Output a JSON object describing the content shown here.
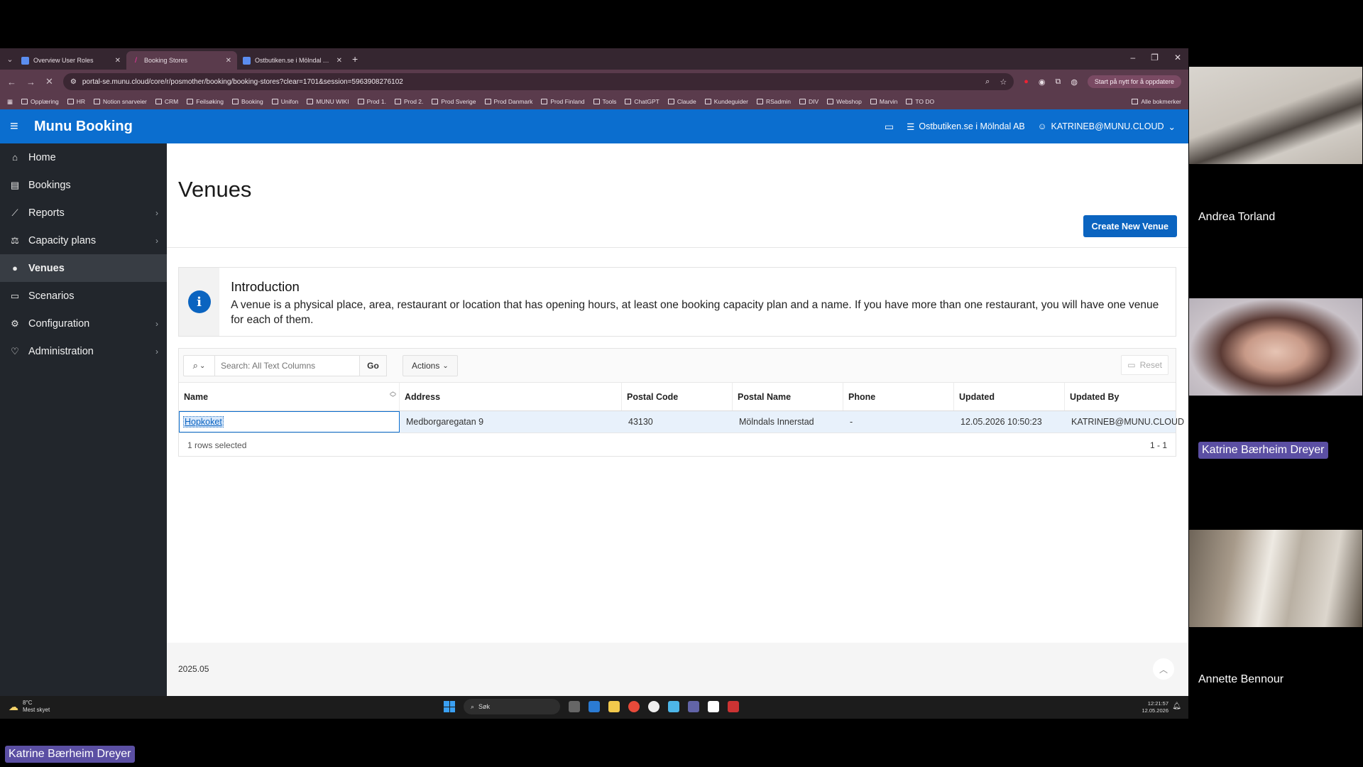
{
  "browser": {
    "tabs": [
      {
        "title": "Overview User Roles"
      },
      {
        "title": "Booking Stores"
      },
      {
        "title": "Ostbutiken.se i Mölndal AB Bo..."
      }
    ],
    "url": "portal-se.munu.cloud/core/r/posmother/booking/booking-stores?clear=1701&session=5963908276102",
    "update_button": "Start på nytt for å oppdatere",
    "bookmarks": [
      "Opplæring",
      "HR",
      "Notion snarveier",
      "CRM",
      "Feilsøking",
      "Booking",
      "Unifon",
      "MUNU WIKI",
      "Prod 1.",
      "Prod 2.",
      "Prod Sverige",
      "Prod Danmark",
      "Prod Finland",
      "Tools",
      "ChatGPT",
      "Claude",
      "Kundeguider",
      "RSadmin",
      "DIV",
      "Webshop",
      "Marvin",
      "TO DO"
    ],
    "bookmarks_right": "Alle bokmerker"
  },
  "app": {
    "title": "Munu Booking",
    "org": "Ostbutiken.se i Mölndal AB",
    "user": "KATRINEB@MUNU.CLOUD"
  },
  "sidebar": {
    "items": [
      {
        "label": "Home",
        "icon": "home-icon"
      },
      {
        "label": "Bookings",
        "icon": "calendar-icon"
      },
      {
        "label": "Reports",
        "icon": "chart-icon"
      },
      {
        "label": "Capacity plans",
        "icon": "capacity-icon"
      },
      {
        "label": "Venues",
        "icon": "location-pin-icon"
      },
      {
        "label": "Scenarios",
        "icon": "scenario-icon"
      },
      {
        "label": "Configuration",
        "icon": "gear-icon"
      },
      {
        "label": "Administration",
        "icon": "admin-icon"
      }
    ]
  },
  "page": {
    "title": "Venues",
    "create_button": "Create New Venue",
    "intro_title": "Introduction",
    "intro_text": "A venue is a physical place, area, restaurant or location that has opening hours, at least one booking capacity plan and a name. If you have more than one restaurant, you will have one venue for each of them."
  },
  "report": {
    "search_placeholder": "Search: All Text Columns",
    "go": "Go",
    "actions": "Actions",
    "reset": "Reset",
    "columns": [
      "Name",
      "Address",
      "Postal Code",
      "Postal Name",
      "Phone",
      "Updated",
      "Updated By"
    ],
    "rows": [
      [
        "Hopkoket",
        "Medborgaregatan 9",
        "43130",
        "Mölndals Innerstad",
        "-",
        "12.05.2026 10:50:23",
        "KATRINEB@MUNU.CLOUD"
      ]
    ],
    "selected_text": "1 rows selected",
    "pagination": "1 - 1"
  },
  "footer": {
    "version": "2025.05"
  },
  "taskbar": {
    "temp": "8°C",
    "weather": "Mest skyet",
    "search": "Søk",
    "time": "12:21:57",
    "date": "12.05.2026"
  },
  "meeting": {
    "participants": [
      "Andrea Torland",
      "Katrine Bærheim Dreyer",
      "Annette Bennour"
    ],
    "presenter": "Katrine Bærheim Dreyer"
  }
}
